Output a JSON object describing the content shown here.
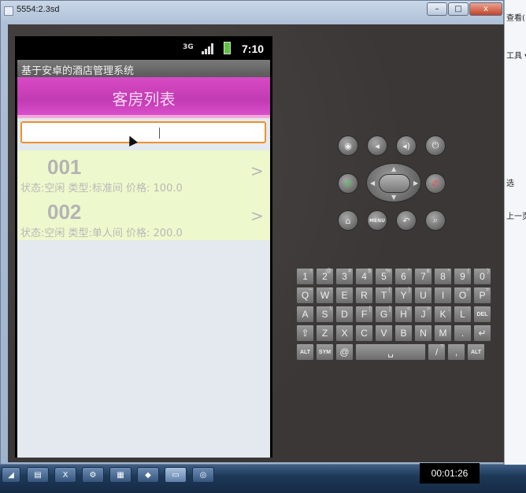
{
  "window": {
    "title": "5554:2.3sd",
    "min": "–",
    "max": "□",
    "close": "x"
  },
  "status_bar": {
    "network": "3G",
    "time": "7:10"
  },
  "app": {
    "title": "基于安卓的酒店管理系统",
    "header": "客房列表",
    "search": {
      "value": "",
      "placeholder": ""
    },
    "rooms": [
      {
        "number": "001",
        "info": "状态:空闲 类型:标准间 价格: 100.0",
        "arrow": ">"
      },
      {
        "number": "002",
        "info": "状态:空闲 类型:单人间 价格: 200.0",
        "arrow": ">"
      }
    ]
  },
  "controls": {
    "menu_label": "MENU"
  },
  "keyboard": {
    "row1": [
      [
        "1",
        "!"
      ],
      [
        "2",
        "@"
      ],
      [
        "3",
        "#"
      ],
      [
        "4",
        "$"
      ],
      [
        "5",
        "%"
      ],
      [
        "6",
        "^"
      ],
      [
        "7",
        "&"
      ],
      [
        "8",
        "*"
      ],
      [
        "9",
        "("
      ],
      [
        "0",
        ")"
      ]
    ],
    "row2": [
      [
        "Q",
        "~"
      ],
      [
        "W",
        "\""
      ],
      [
        "E",
        ""
      ],
      [
        "R",
        ""
      ],
      [
        "T",
        "{"
      ],
      [
        "Y",
        "}"
      ],
      [
        "U",
        "-"
      ],
      [
        "I",
        ""
      ],
      [
        "O",
        "+"
      ],
      [
        "P",
        "="
      ]
    ],
    "row3": [
      [
        "A",
        ""
      ],
      [
        "S",
        "\\"
      ],
      [
        "D",
        ""
      ],
      [
        "F",
        "["
      ],
      [
        "G",
        "]"
      ],
      [
        "H",
        "<"
      ],
      [
        "J",
        ">"
      ],
      [
        "K",
        ";"
      ],
      [
        "L",
        ":"
      ],
      [
        "DEL",
        ""
      ]
    ],
    "row4": [
      [
        "⇧",
        ""
      ],
      [
        "Z",
        ""
      ],
      [
        "X",
        ""
      ],
      [
        "C",
        ""
      ],
      [
        "V",
        ""
      ],
      [
        "B",
        ""
      ],
      [
        "N",
        ""
      ],
      [
        "M",
        ""
      ],
      [
        ".",
        ""
      ],
      [
        "↵",
        ""
      ]
    ],
    "row5": [
      [
        "ALT",
        ""
      ],
      [
        "SYM",
        ""
      ],
      [
        "@",
        ""
      ],
      [
        "␣",
        ""
      ],
      [
        "/",
        "?"
      ],
      [
        ",",
        ""
      ],
      [
        "ALT",
        ""
      ]
    ]
  },
  "side_panel": {
    "t1": "查看(",
    "t2": "工具 ▾",
    "t3": "选",
    "t4": "上一页"
  },
  "taskbar": {
    "clock": "00:01:26"
  },
  "colors": {
    "header": "#c23bb3",
    "search_border": "#f0902a",
    "list_bg": "#edf8cc"
  }
}
